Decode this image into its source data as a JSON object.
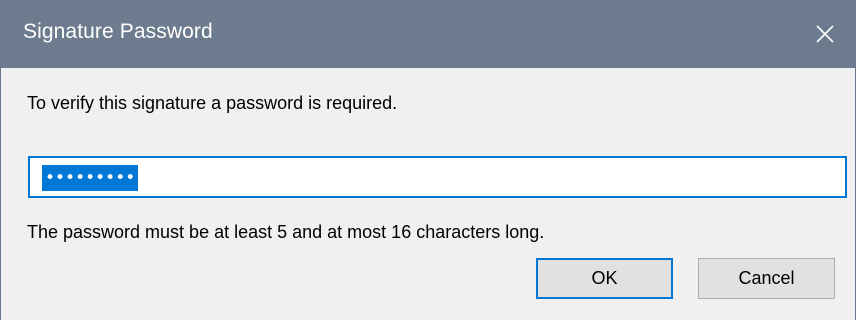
{
  "dialog": {
    "title": "Signature Password",
    "close_icon": "close-icon",
    "message": "To verify this signature a password is required.",
    "password_value": "•••••••••",
    "hint": "The password must be at least 5 and at most 16 characters long.",
    "ok_label": "OK",
    "cancel_label": "Cancel"
  },
  "colors": {
    "titlebar": "#6c7b8d",
    "accent": "#0078d7",
    "background": "#f0f0f0",
    "button": "#e1e1e1"
  }
}
